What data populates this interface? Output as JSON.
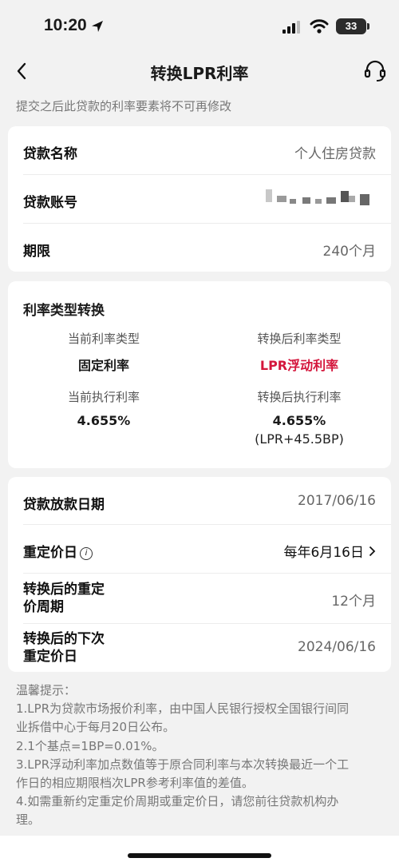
{
  "status_bar": {
    "time": "10:20",
    "battery": "33"
  },
  "nav": {
    "title": "转换LPR利率"
  },
  "notice": "提交之后此贷款的利率要素将不可再修改",
  "loan_info": {
    "name_label": "贷款名称",
    "name_value": "个人住房贷款",
    "account_label": "贷款账号",
    "term_label": "期限",
    "term_value": "240个月"
  },
  "conversion": {
    "title": "利率类型转换",
    "current_type_label": "当前利率类型",
    "current_type_value": "固定利率",
    "new_type_label": "转换后利率类型",
    "new_type_value": "LPR浮动利率",
    "current_rate_label": "当前执行利率",
    "current_rate_value": "4.655%",
    "new_rate_label": "转换后执行利率",
    "new_rate_value": "4.655%",
    "new_rate_formula": "(LPR+45.5BP)",
    "accent_color": "#d4163c"
  },
  "dates": {
    "release_label": "贷款放款日期",
    "release_value": "2017/06/16",
    "reprice_label": "重定价日",
    "reprice_value": "每年6月16日",
    "period_label_1": "转换后的重定",
    "period_label_2": "价周期",
    "period_value": "12个月",
    "next_label_1": "转换后的下次",
    "next_label_2": "重定价日",
    "next_value": "2024/06/16"
  },
  "tips": {
    "heading": "温馨提示：",
    "lines": [
      "1.LPR为贷款市场报价利率，由中国人民银行授权全国银行间同",
      "业拆借中心于每月20日公布。",
      "2.1个基点=1BP=0.01%。",
      "3.LPR浮动利率加点数值等于原合同利率与本次转换最近一个工",
      "作日的相应期限档次LPR参考利率值的差值。",
      "4.如需重新约定重定价周期或重定价日，请您前往贷款机构办",
      "理。"
    ]
  }
}
